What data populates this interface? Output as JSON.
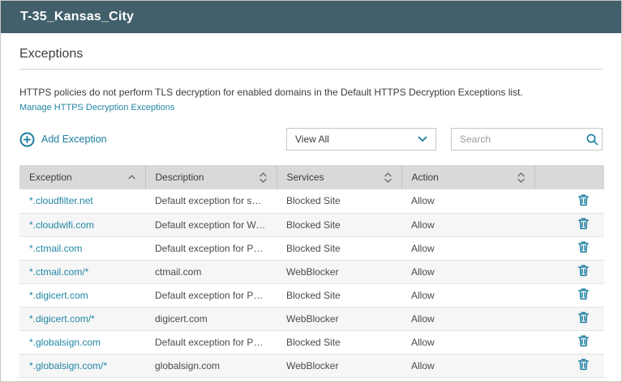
{
  "header": {
    "title": "T-35_Kansas_City"
  },
  "section": {
    "title": "Exceptions"
  },
  "description": "HTTPS policies do not perform TLS decryption for enabled domains in the Default HTTPS Decryption Exceptions list.",
  "manage_link": "Manage HTTPS Decryption Exceptions",
  "toolbar": {
    "add_exception_label": "Add Exception",
    "filter_value": "View All",
    "search_placeholder": "Search"
  },
  "icons": {
    "add": "plus-circle-icon",
    "dropdown": "chevron-down-icon",
    "search": "search-icon",
    "delete": "trash-icon"
  },
  "colors": {
    "accent": "#1b7e9f",
    "link": "#2286a5",
    "titlebar_bg": "#41606b",
    "table_header_bg": "#d9d9d9"
  },
  "table": {
    "columns": [
      {
        "label": "Exception",
        "sort": "asc"
      },
      {
        "label": "Description",
        "sort": "both"
      },
      {
        "label": "Services",
        "sort": "both"
      },
      {
        "label": "Action",
        "sort": "both"
      }
    ],
    "rows": [
      {
        "exception": "*.cloudfilter.net",
        "description": "Default exception for spa...",
        "services": "Blocked Site",
        "action": "Allow"
      },
      {
        "exception": "*.cloudwifi.com",
        "description": "Default exception for Wat...",
        "services": "Blocked Site",
        "action": "Allow"
      },
      {
        "exception": "*.ctmail.com",
        "description": "Default exception for Pan...",
        "services": "Blocked Site",
        "action": "Allow"
      },
      {
        "exception": "*.ctmail.com/*",
        "description": "ctmail.com",
        "services": "WebBlocker",
        "action": "Allow"
      },
      {
        "exception": "*.digicert.com",
        "description": "Default exception for Pan...",
        "services": "Blocked Site",
        "action": "Allow"
      },
      {
        "exception": "*.digicert.com/*",
        "description": "digicert.com",
        "services": "WebBlocker",
        "action": "Allow"
      },
      {
        "exception": "*.globalsign.com",
        "description": "Default exception for Pan...",
        "services": "Blocked Site",
        "action": "Allow"
      },
      {
        "exception": "*.globalsign.com/*",
        "description": "globalsign.com",
        "services": "WebBlocker",
        "action": "Allow"
      }
    ]
  }
}
